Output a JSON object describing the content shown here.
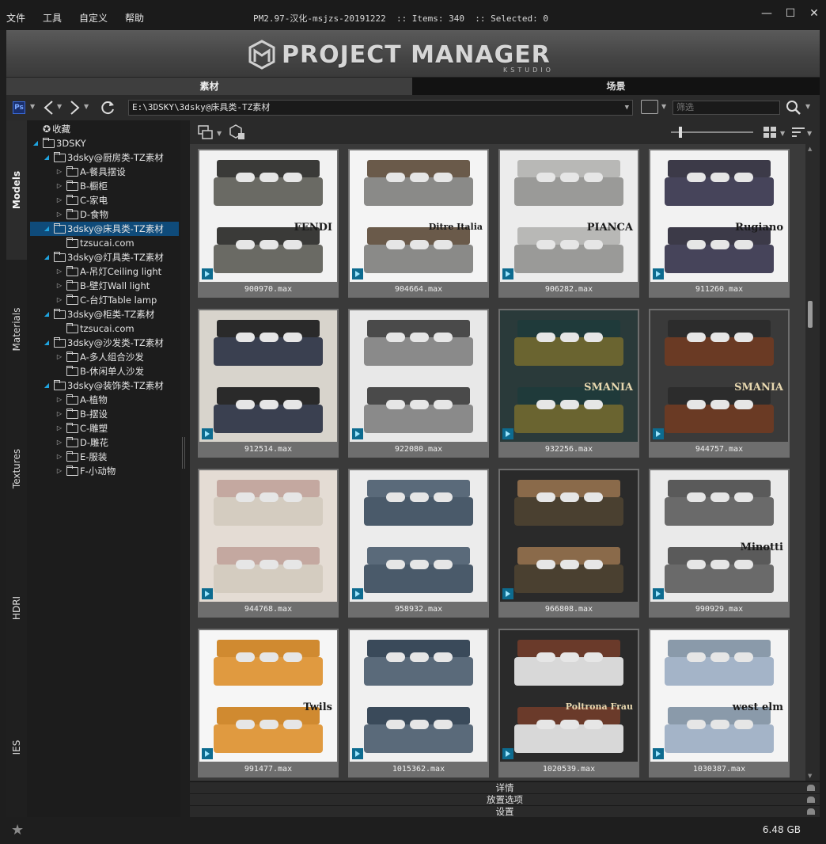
{
  "menu": [
    "文件",
    "工具",
    "自定义",
    "帮助"
  ],
  "window_title": "PM2.97-汉化-msjzs-20191222  :: Items: 340  :: Selected: 0",
  "window_controls": {
    "minimize": "—",
    "maximize": "☐",
    "close": "✕"
  },
  "banner": {
    "title": "PROJECT MANAGER",
    "subtitle": "KSTUDIO"
  },
  "main_tabs": [
    {
      "label": "素材",
      "active": true
    },
    {
      "label": "场景",
      "active": false
    }
  ],
  "path": "E:\\3DSKY\\3dsky@床具类-TZ素材",
  "filter_placeholder": "筛选",
  "ps_badge": "Ps",
  "side_tabs": [
    "Models",
    "Materials",
    "Textures",
    "HDRI",
    "IES"
  ],
  "active_side_tab": "Models",
  "tree": [
    {
      "label": "收藏",
      "level": 0,
      "icon": "star",
      "arrow": "none"
    },
    {
      "label": "3DSKY",
      "level": 0,
      "icon": "folder",
      "arrow": "open"
    },
    {
      "label": "3dsky@厨房类-TZ素材",
      "level": 1,
      "icon": "folder",
      "arrow": "open"
    },
    {
      "label": "A-餐具摆设",
      "level": 2,
      "icon": "folder",
      "arrow": "closed"
    },
    {
      "label": "B-橱柜",
      "level": 2,
      "icon": "folder",
      "arrow": "closed"
    },
    {
      "label": "C-家电",
      "level": 2,
      "icon": "folder",
      "arrow": "closed"
    },
    {
      "label": "D-食物",
      "level": 2,
      "icon": "folder",
      "arrow": "closed"
    },
    {
      "label": "3dsky@床具类-TZ素材",
      "level": 1,
      "icon": "folder",
      "arrow": "open",
      "selected": true
    },
    {
      "label": "tzsucai.com",
      "level": 2,
      "icon": "folder",
      "arrow": "none"
    },
    {
      "label": "3dsky@灯具类-TZ素材",
      "level": 1,
      "icon": "folder",
      "arrow": "open"
    },
    {
      "label": "A-吊灯Ceiling light",
      "level": 2,
      "icon": "folder",
      "arrow": "closed"
    },
    {
      "label": "B-壁灯Wall light",
      "level": 2,
      "icon": "folder",
      "arrow": "closed"
    },
    {
      "label": "C-台灯Table lamp",
      "level": 2,
      "icon": "folder",
      "arrow": "closed"
    },
    {
      "label": "3dsky@柜类-TZ素材",
      "level": 1,
      "icon": "folder",
      "arrow": "open"
    },
    {
      "label": "tzsucai.com",
      "level": 2,
      "icon": "folder",
      "arrow": "none"
    },
    {
      "label": "3dsky@沙发类-TZ素材",
      "level": 1,
      "icon": "folder",
      "arrow": "open"
    },
    {
      "label": "A-多人组合沙发",
      "level": 2,
      "icon": "folder",
      "arrow": "closed"
    },
    {
      "label": "B-休闲单人沙发",
      "level": 2,
      "icon": "folder",
      "arrow": "none"
    },
    {
      "label": "3dsky@装饰类-TZ素材",
      "level": 1,
      "icon": "folder",
      "arrow": "open"
    },
    {
      "label": "A-植物",
      "level": 2,
      "icon": "folder",
      "arrow": "closed"
    },
    {
      "label": "B-摆设",
      "level": 2,
      "icon": "folder",
      "arrow": "closed"
    },
    {
      "label": "C-雕塑",
      "level": 2,
      "icon": "folder",
      "arrow": "closed"
    },
    {
      "label": "D-雕花",
      "level": 2,
      "icon": "folder",
      "arrow": "closed"
    },
    {
      "label": "E-服装",
      "level": 2,
      "icon": "folder",
      "arrow": "closed"
    },
    {
      "label": "F-小动物",
      "level": 2,
      "icon": "folder",
      "arrow": "closed"
    }
  ],
  "items": [
    {
      "file": "900970.max",
      "top": "#3a3a38",
      "bed": "#6a6a64",
      "bg": "#f2f2f2",
      "brand": "FENDI"
    },
    {
      "file": "904664.max",
      "top": "#6a5a4a",
      "bed": "#8a8a88",
      "bg": "#f4f4f4",
      "brand": "Ditre Italia"
    },
    {
      "file": "906282.max",
      "top": "#b8b8b6",
      "bed": "#9a9a98",
      "bg": "#ececec",
      "brand": "PIANCA"
    },
    {
      "file": "911260.max",
      "top": "#3c3a48",
      "bed": "#46445a",
      "bg": "#f2f2f2",
      "brand": "Rugiano"
    },
    {
      "file": "912514.max",
      "top": "#2a2a2a",
      "bed": "#3a4050",
      "bg": "#d8d4cc",
      "brand": ""
    },
    {
      "file": "922080.max",
      "top": "#4a4a4a",
      "bed": "#8a8a8a",
      "bg": "#e8e8e8",
      "brand": ""
    },
    {
      "file": "932256.max",
      "top": "#1f3a3a",
      "bed": "#6a6430",
      "bg": "#2a3a3a",
      "brand": "SMANIA"
    },
    {
      "file": "944757.max",
      "top": "#2c2c2c",
      "bed": "#6a3a24",
      "bg": "#3a3a3a",
      "brand": "SMANIA"
    },
    {
      "file": "944768.max",
      "top": "#c4a8a0",
      "bed": "#d4ccc0",
      "bg": "#e4dcd4",
      "brand": ""
    },
    {
      "file": "958932.max",
      "top": "#5a6a7a",
      "bed": "#4a5a6a",
      "bg": "#ececec",
      "brand": ""
    },
    {
      "file": "966808.max",
      "top": "#8a6a4a",
      "bed": "#4a4030",
      "bg": "#2a2a2a",
      "brand": ""
    },
    {
      "file": "990929.max",
      "top": "#5a5a5a",
      "bed": "#6a6a6a",
      "bg": "#eaeaea",
      "brand": "Minotti"
    },
    {
      "file": "991477.max",
      "top": "#d08a30",
      "bed": "#e09a40",
      "bg": "#f6f6f6",
      "brand": "Twils"
    },
    {
      "file": "1015362.max",
      "top": "#3a4a5a",
      "bed": "#5a6a7a",
      "bg": "#f0f0f0",
      "brand": ""
    },
    {
      "file": "1020539.max",
      "top": "#6a3a2a",
      "bed": "#d8d8d8",
      "bg": "#2a2a2a",
      "brand": "Poltrona Frau"
    },
    {
      "file": "1030387.max",
      "top": "#8a9aaa",
      "bed": "#a4b4c8",
      "bg": "#f4f4f4",
      "brand": "west elm"
    }
  ],
  "panels": [
    "详情",
    "放置选项",
    "设置"
  ],
  "status_size": "6.48 GB",
  "icons": {
    "back": "back-arrow-icon",
    "forward": "forward-arrow-icon",
    "refresh": "refresh-icon",
    "search": "search-icon",
    "view": "grid-view-icon",
    "sort": "sort-icon",
    "favorite": "star-icon"
  }
}
